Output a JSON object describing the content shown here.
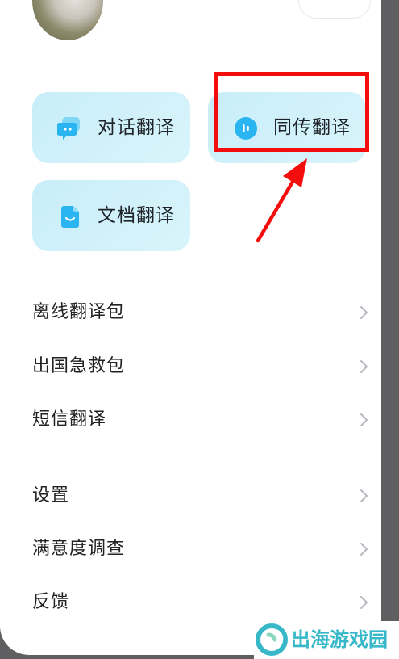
{
  "cards": {
    "conversation": {
      "label": "对话翻译",
      "icon": "chat-bubble-icon"
    },
    "simultaneous": {
      "label": "同传翻译",
      "icon": "voice-wave-icon"
    },
    "document": {
      "label": "文档翻译",
      "icon": "document-icon"
    }
  },
  "menu": {
    "items": [
      {
        "label": "离线翻译包"
      },
      {
        "label": "出国急救包"
      },
      {
        "label": "短信翻译"
      },
      {
        "label": "设置"
      },
      {
        "label": "满意度调查"
      },
      {
        "label": "反馈"
      }
    ]
  },
  "annotation": {
    "color": "#f40d0d"
  },
  "watermark": {
    "text": "出海游戏园",
    "color": "#37b8c8"
  },
  "colors": {
    "card_bg": "#c8eef9",
    "icon_blue": "#2ab4f0"
  }
}
